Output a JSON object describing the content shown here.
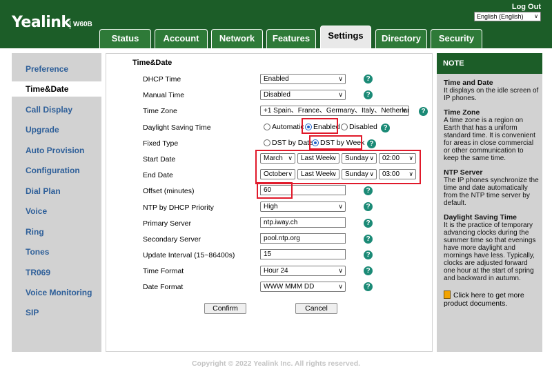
{
  "header": {
    "brand": "Yealink",
    "model": "W60B",
    "logout": "Log Out",
    "language": "English (English)"
  },
  "tabs": [
    {
      "label": "Status"
    },
    {
      "label": "Account"
    },
    {
      "label": "Network"
    },
    {
      "label": "Features"
    },
    {
      "label": "Settings",
      "active": true
    },
    {
      "label": "Directory"
    },
    {
      "label": "Security"
    }
  ],
  "sidebar": {
    "items": [
      {
        "label": "Preference"
      },
      {
        "label": "Time&Date",
        "active": true
      },
      {
        "label": "Call Display"
      },
      {
        "label": "Upgrade"
      },
      {
        "label": "Auto Provision"
      },
      {
        "label": "Configuration"
      },
      {
        "label": "Dial Plan"
      },
      {
        "label": "Voice"
      },
      {
        "label": "Ring"
      },
      {
        "label": "Tones"
      },
      {
        "label": "TR069"
      },
      {
        "label": "Voice Monitoring"
      },
      {
        "label": "SIP"
      }
    ]
  },
  "form": {
    "section_title": "Time&Date",
    "dhcp_time": {
      "label": "DHCP Time",
      "value": "Enabled"
    },
    "manual_time": {
      "label": "Manual Time",
      "value": "Disabled"
    },
    "time_zone": {
      "label": "Time Zone",
      "value": "+1 Spain、France、Germany、Italy、Netherlan"
    },
    "daylight_saving": {
      "label": "Daylight Saving Time",
      "options": [
        "Automatic",
        "Enabled",
        "Disabled"
      ],
      "selected": "Enabled"
    },
    "fixed_type": {
      "label": "Fixed Type",
      "options": [
        "DST by Date",
        "DST by Week"
      ],
      "selected": "DST by Week"
    },
    "start_date": {
      "label": "Start Date",
      "month": "March",
      "week": "Last Week",
      "day": "Sunday",
      "hour": "02:00"
    },
    "end_date": {
      "label": "End Date",
      "month": "October",
      "week": "Last Week",
      "day": "Sunday",
      "hour": "03:00"
    },
    "offset": {
      "label": "Offset (minutes)",
      "value": "60"
    },
    "ntp_dhcp_priority": {
      "label": "NTP by DHCP Priority",
      "value": "High"
    },
    "primary_server": {
      "label": "Primary Server",
      "value": "ntp.iway.ch"
    },
    "secondary_server": {
      "label": "Secondary Server",
      "value": "pool.ntp.org"
    },
    "update_interval": {
      "label": "Update Interval (15~86400s)",
      "value": "15"
    },
    "time_format": {
      "label": "Time Format",
      "value": "Hour 24"
    },
    "date_format": {
      "label": "Date Format",
      "value": "WWW MMM DD"
    },
    "confirm": "Confirm",
    "cancel": "Cancel"
  },
  "note": {
    "title": "NOTE",
    "sections": [
      {
        "heading": "Time and Date",
        "text": "It displays on the idle screen of IP phones."
      },
      {
        "heading": "Time Zone",
        "text": "A time zone is a region on Earth that has a uniform standard time. It is convenient for areas in close commercial or other communication to keep the same time."
      },
      {
        "heading": "NTP Server",
        "text": "The IP phones synchronize the time and date automatically from the NTP time server by default."
      },
      {
        "heading": "Daylight Saving Time",
        "text": "It is the practice of temporary advancing clocks during the summer time so that evenings have more daylight and mornings have less. Typically, clocks are adjusted forward one hour at the start of spring and backward in autumn."
      }
    ],
    "link": "Click here to get more product documents."
  },
  "footer": "Copyright © 2022 Yealink Inc. All rights reserved.",
  "help_glyph": "?",
  "arrow_glyph": "∨",
  "colors": {
    "brand_green": "#1c5d28",
    "highlight_red": "#e0192a",
    "help_teal": "#1b8a76",
    "nav_link": "#2e5f99"
  }
}
